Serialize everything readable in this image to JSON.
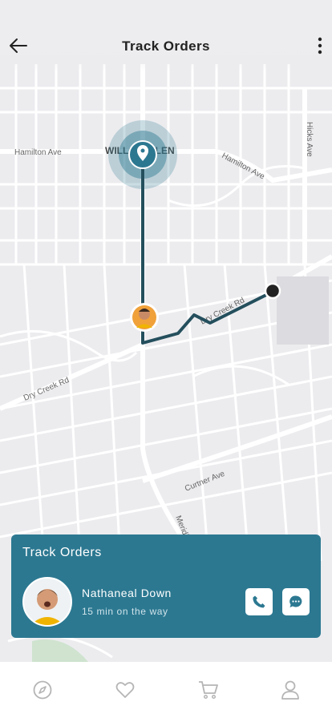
{
  "header": {
    "title": "Track Orders"
  },
  "map": {
    "streets": [
      "Hamilton Ave",
      "Hamilton Ave",
      "Hicks Ave",
      "Dry Creek Rd",
      "Dry Creek Rd",
      "Curtner Ave",
      "Meridian"
    ],
    "area_label": "WILLOW GLEN",
    "route_color": "#244f5d"
  },
  "card": {
    "title": "Track Orders",
    "courier_name": "Nathaneal Down",
    "eta": "15 min on the way",
    "accent": "#2c7891"
  },
  "tabs": [
    "compass-icon",
    "heart-icon",
    "cart-icon",
    "profile-icon"
  ]
}
